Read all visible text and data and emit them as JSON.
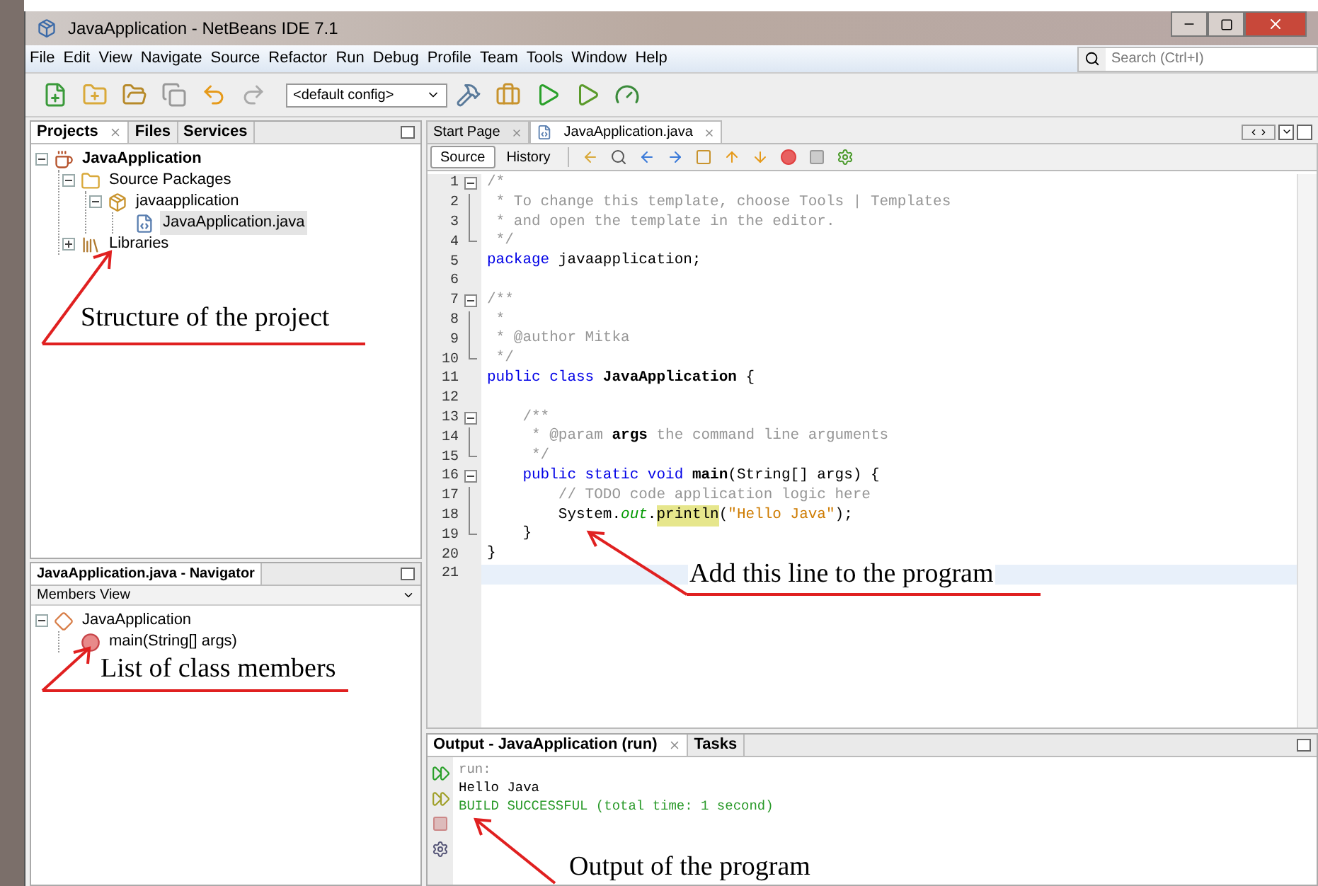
{
  "window": {
    "title": "JavaApplication - NetBeans IDE 7.1"
  },
  "menu": [
    "File",
    "Edit",
    "View",
    "Navigate",
    "Source",
    "Refactor",
    "Run",
    "Debug",
    "Profile",
    "Team",
    "Tools",
    "Window",
    "Help"
  ],
  "search": {
    "placeholder": "Search (Ctrl+I)"
  },
  "toolbar": {
    "config": "<default config>"
  },
  "projects_panel": {
    "tabs": [
      {
        "label": "Projects",
        "selected": true
      },
      {
        "label": "Files",
        "selected": false
      },
      {
        "label": "Services",
        "selected": false
      }
    ],
    "tree": [
      {
        "label": "JavaApplication",
        "kind": "project",
        "bold": true,
        "expanded": true,
        "selected": false,
        "children": [
          {
            "label": "Source Packages",
            "kind": "folder",
            "bold": false,
            "expanded": true,
            "selected": false,
            "children": [
              {
                "label": "javaapplication",
                "kind": "package",
                "bold": false,
                "expanded": true,
                "selected": false,
                "children": [
                  {
                    "label": "JavaApplication.java",
                    "kind": "file",
                    "bold": false,
                    "selected": true
                  }
                ]
              }
            ]
          },
          {
            "label": "Libraries",
            "kind": "library",
            "bold": false,
            "expanded": false,
            "selected": false
          }
        ]
      }
    ]
  },
  "navigator": {
    "title": "JavaApplication.java - Navigator",
    "view": "Members View",
    "tree": [
      {
        "label": "JavaApplication",
        "kind": "class",
        "expanded": true,
        "children": [
          {
            "label": "main(String[] args)",
            "kind": "method"
          }
        ]
      }
    ]
  },
  "editor": {
    "tabs": [
      {
        "label": "Start Page",
        "selected": false
      },
      {
        "label": "JavaApplication.java",
        "selected": true
      }
    ],
    "views": [
      {
        "label": "Source",
        "selected": true
      },
      {
        "label": "History",
        "selected": false
      }
    ],
    "lines": [
      {
        "number": "1",
        "kind": "fold-start",
        "current": false,
        "tokens": [
          {
            "kind": "comment",
            "text": "/*"
          }
        ]
      },
      {
        "number": "2",
        "kind": "fold-body",
        "current": false,
        "tokens": [
          {
            "kind": "comment",
            "text": " * To change this template, choose Tools | Templates"
          }
        ]
      },
      {
        "number": "3",
        "kind": "fold-body",
        "current": false,
        "tokens": [
          {
            "kind": "comment",
            "text": " * and open the template in the editor."
          }
        ]
      },
      {
        "number": "4",
        "kind": "fold-end",
        "current": false,
        "tokens": [
          {
            "kind": "comment",
            "text": " */"
          }
        ]
      },
      {
        "number": "5",
        "kind": "plain",
        "current": false,
        "tokens": [
          {
            "kind": "keyword",
            "text": "package"
          },
          {
            "kind": "plain",
            "text": " javaapplication;"
          }
        ]
      },
      {
        "number": "6",
        "kind": "plain",
        "current": false
      },
      {
        "number": "7",
        "kind": "fold-start",
        "current": false,
        "tokens": [
          {
            "kind": "comment",
            "text": "/**"
          }
        ]
      },
      {
        "number": "8",
        "kind": "fold-body",
        "current": false,
        "tokens": [
          {
            "kind": "comment",
            "text": " *"
          }
        ]
      },
      {
        "number": "9",
        "kind": "fold-body",
        "current": false,
        "tokens": [
          {
            "kind": "comment",
            "text": " * @author Mitka"
          }
        ]
      },
      {
        "number": "10",
        "kind": "fold-end",
        "current": false,
        "tokens": [
          {
            "kind": "comment",
            "text": " */"
          }
        ]
      },
      {
        "number": "11",
        "kind": "plain",
        "current": false,
        "tokens": [
          {
            "kind": "keyword",
            "text": "public class "
          },
          {
            "kind": "bold",
            "text": "JavaApplication"
          },
          {
            "kind": "plain",
            "text": " {"
          }
        ]
      },
      {
        "number": "12",
        "kind": "plain",
        "current": false
      },
      {
        "number": "13",
        "kind": "fold-start",
        "current": false,
        "tokens": [
          {
            "kind": "comment",
            "text": "    /**"
          }
        ]
      },
      {
        "number": "14",
        "kind": "fold-body",
        "current": false,
        "tokens": [
          {
            "kind": "comment",
            "text": "     * @param "
          },
          {
            "kind": "bold",
            "text": "args"
          },
          {
            "kind": "comment",
            "text": " the command line arguments"
          }
        ]
      },
      {
        "number": "15",
        "kind": "fold-end",
        "current": false,
        "tokens": [
          {
            "kind": "comment",
            "text": "     */"
          }
        ]
      },
      {
        "number": "16",
        "kind": "fold-start",
        "current": false,
        "tokens": [
          {
            "kind": "keyword",
            "text": "    public static void "
          },
          {
            "kind": "bold",
            "text": "main"
          },
          {
            "kind": "plain",
            "text": "(String[] args) {"
          }
        ]
      },
      {
        "number": "17",
        "kind": "fold-body",
        "current": false,
        "tokens": [
          {
            "kind": "comment",
            "text": "        // TODO code application logic here"
          }
        ]
      },
      {
        "number": "18",
        "kind": "fold-body",
        "current": false,
        "tokens": [
          {
            "kind": "plain",
            "text": "        System."
          },
          {
            "kind": "field",
            "text": "out"
          },
          {
            "kind": "plain",
            "text": "."
          },
          {
            "kind": "highlight",
            "text": "println"
          },
          {
            "kind": "plain",
            "text": "("
          },
          {
            "kind": "string",
            "text": "\"Hello Java\""
          },
          {
            "kind": "plain",
            "text": ");"
          }
        ]
      },
      {
        "number": "19",
        "kind": "fold-end",
        "current": false,
        "tokens": [
          {
            "kind": "plain",
            "text": "    }"
          }
        ]
      },
      {
        "number": "20",
        "kind": "plain",
        "current": false,
        "tokens": [
          {
            "kind": "plain",
            "text": "}"
          }
        ]
      },
      {
        "number": "21",
        "kind": "plain",
        "current": true
      }
    ]
  },
  "output": {
    "tabs": [
      {
        "label": "Output - JavaApplication (run)",
        "selected": true
      },
      {
        "label": "Tasks",
        "selected": false
      }
    ],
    "lines": [
      {
        "kind": "info",
        "text": "run:"
      },
      {
        "kind": "plain",
        "text": "Hello Java"
      },
      {
        "kind": "success",
        "text": "BUILD SUCCESSFUL (total time: 1 second)"
      }
    ]
  },
  "annotations": [
    {
      "text": "Structure of the project"
    },
    {
      "text": "List of class members"
    },
    {
      "text": "Add this line to the program"
    },
    {
      "text": "Output of the program"
    }
  ]
}
